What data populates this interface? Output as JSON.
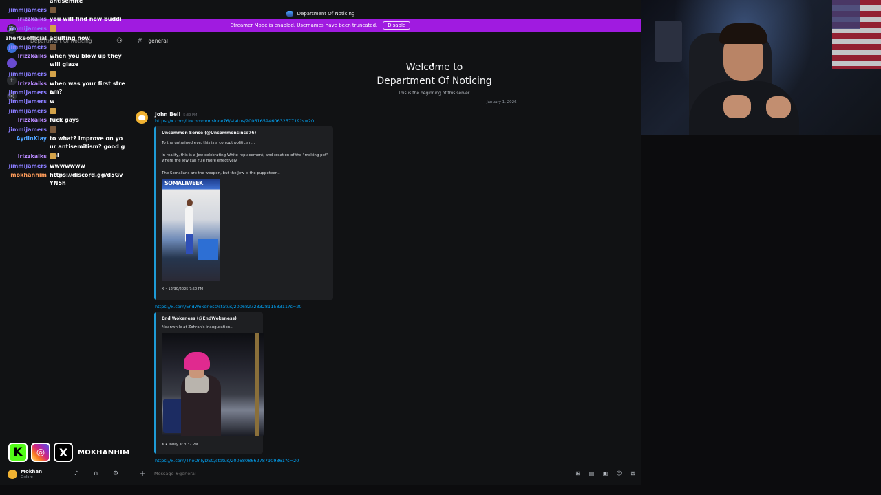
{
  "window": {
    "title": "Department Of Noticing",
    "streamer_bar": {
      "text": "Streamer Mode is enabled. Usernames have been truncated.",
      "button": "Disable"
    }
  },
  "sidebar": {
    "server_name": "Department Of Noticing",
    "active_channel": "general"
  },
  "channel": {
    "name": "general",
    "welcome_title_line1": "Welcome to",
    "welcome_title_line2": "Department Of Noticing",
    "welcome_subtitle": "This is the beginning of this server.",
    "date_separator": "January 1, 2026"
  },
  "message": {
    "author": "John Bell",
    "time": "5:39 PM",
    "link1": "https://x.com/Uncommonsince76/status/2006165946063257719?s=20",
    "embed1": {
      "author": "Uncommon Sense (@Uncommonsince76)",
      "text1": "To the untrained eye, this is a corrupt politician...",
      "text2": "In reality, this is a Jew celebrating White replacement, and creation of the \"melting pot\" where the Jew can rule more effectively.",
      "text3": "The Somalians are the weapon, but the Jew is the puppeteer...",
      "image_banner": "SOMALIWEEK",
      "footer": "X • 12/30/2025 7:50 PM"
    },
    "link2": "https://x.com/EndWokeness/status/2006827233281158311?s=20",
    "embed2": {
      "author": "End Wokeness (@EndWokeness)",
      "text1": "Meanwhile at Zohran's inauguration...",
      "footer": "X • Today at 3:37 PM"
    },
    "link3": "https://x.com/TheOnlyDSC/status/2006808662787109361?s=20"
  },
  "composer": {
    "placeholder": "Message #general"
  },
  "user_panel": {
    "name": "Mokhan",
    "status": "Online"
  },
  "chat_overlay": [
    {
      "user": "",
      "msg": "antisemite",
      "color": "#b388ff"
    },
    {
      "user": "jimmijamers",
      "msg": "",
      "color": "#8a7dff"
    },
    {
      "user": "lrizzkaiks",
      "msg": "you will find new buddies",
      "color": "#b98aff"
    },
    {
      "user": "jimmijamers",
      "msg": "",
      "color": "#8a7dff"
    },
    {
      "user": "zherkeofficial",
      "msg": "adulting now",
      "color": "#e0e0e0"
    },
    {
      "user": "jimmijamers",
      "msg": "",
      "color": "#8a7dff"
    },
    {
      "user": "lrizzkaiks",
      "msg": "when you blow up they will glaze",
      "color": "#b98aff"
    },
    {
      "user": "jimmijamers",
      "msg": "",
      "color": "#8a7dff"
    },
    {
      "user": "lrizzkaiks",
      "msg": "when was your first stream?",
      "color": "#b98aff"
    },
    {
      "user": "jimmijamers",
      "msg": "w",
      "color": "#8a7dff"
    },
    {
      "user": "jimmijamers",
      "msg": "w",
      "color": "#8a7dff"
    },
    {
      "user": "jimmijamers",
      "msg": "",
      "color": "#8a7dff"
    },
    {
      "user": "lrizzkaiks",
      "msg": "fuck gays",
      "color": "#b98aff"
    },
    {
      "user": "jimmijamers",
      "msg": "",
      "color": "#8a7dff"
    },
    {
      "user": "AydinKlay",
      "msg": "to what? improve on your antisemitism? good goal",
      "color": "#4fa3ff"
    },
    {
      "user": "lrizzkaiks",
      "msg": "",
      "color": "#b98aff"
    },
    {
      "user": "jimmijamers",
      "msg": "wwwwwww",
      "color": "#8a7dff"
    },
    {
      "user": "mokhanhim",
      "msg": "https://discord.gg/d5GvYN5h",
      "color": "#ff9c5a"
    }
  ],
  "socials": {
    "kick_icon": "K",
    "instagram_icon": "◎",
    "x_icon": "X",
    "handle": "MOKHANHIM"
  },
  "colors": {
    "accent": "#a01be0",
    "link": "#00a8fc",
    "embed_border": "#1e9bd7",
    "background": "#111214"
  }
}
